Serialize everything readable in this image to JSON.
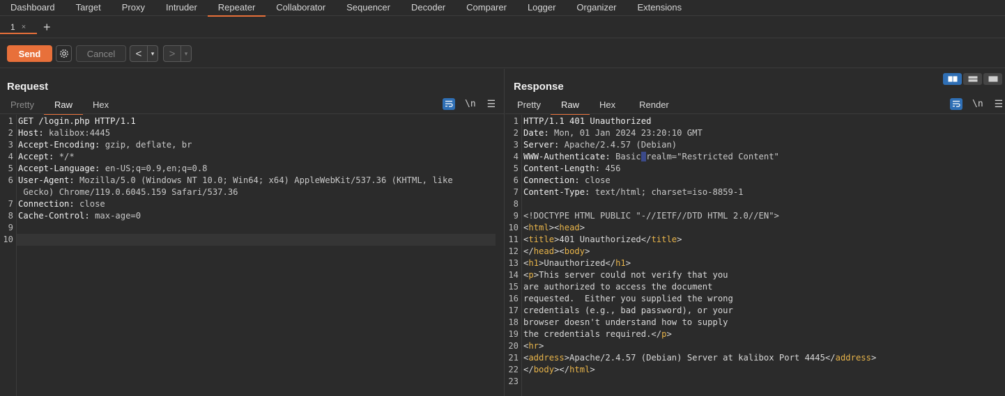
{
  "topnav": [
    "Dashboard",
    "Target",
    "Proxy",
    "Intruder",
    "Repeater",
    "Collaborator",
    "Sequencer",
    "Decoder",
    "Comparer",
    "Logger",
    "Organizer",
    "Extensions"
  ],
  "subtabs": {
    "tab_label": "1",
    "close": "×",
    "add": "+"
  },
  "toolbar": {
    "send": "Send",
    "cancel": "Cancel",
    "back": "<",
    "forward": ">",
    "drop": "▾"
  },
  "request": {
    "title": "Request",
    "tabs": [
      "Pretty",
      "Raw",
      "Hex"
    ],
    "nl": "\\n",
    "lines": [
      {
        "n": "1",
        "k": "",
        "v": "GET /login.php HTTP/1.1"
      },
      {
        "n": "2",
        "k": "Host:",
        "v": " kalibox:4445"
      },
      {
        "n": "3",
        "k": "Accept-Encoding:",
        "v": " gzip, deflate, br"
      },
      {
        "n": "4",
        "k": "Accept:",
        "v": " */*"
      },
      {
        "n": "5",
        "k": "Accept-Language:",
        "v": " en-US;q=0.9,en;q=0.8"
      },
      {
        "n": "6",
        "k": "User-Agent:",
        "v": " Mozilla/5.0 (Windows NT 10.0; Win64; x64) AppleWebKit/537.36 (KHTML, like"
      },
      {
        "n": "",
        "k": "",
        "v": " Gecko) Chrome/119.0.6045.159 Safari/537.36"
      },
      {
        "n": "7",
        "k": "Connection:",
        "v": " close"
      },
      {
        "n": "8",
        "k": "Cache-Control:",
        "v": " max-age=0"
      },
      {
        "n": "9",
        "k": "",
        "v": ""
      },
      {
        "n": "10",
        "k": "",
        "v": ""
      }
    ]
  },
  "response": {
    "title": "Response",
    "tabs": [
      "Pretty",
      "Raw",
      "Hex",
      "Render"
    ],
    "nl": "\\n",
    "header_lines": [
      {
        "n": "1",
        "k": "",
        "v": "HTTP/1.1 401 Unauthorized"
      },
      {
        "n": "2",
        "k": "Date:",
        "v": " Mon, 01 Jan 2024 23:20:10 GMT"
      },
      {
        "n": "3",
        "k": "Server:",
        "v": " Apache/2.4.57 (Debian)"
      },
      {
        "n": "5",
        "k": "Content-Length:",
        "v": " 456"
      },
      {
        "n": "6",
        "k": "Connection:",
        "v": " close"
      },
      {
        "n": "7",
        "k": "Content-Type:",
        "v": " text/html; charset=iso-8859-1"
      },
      {
        "n": "8",
        "k": "",
        "v": ""
      }
    ],
    "www_auth": {
      "n": "4",
      "k": "WWW-Authenticate:",
      "v1": " Basic",
      "sp": " ",
      "v2": "realm=\"Restricted Content\""
    },
    "doctype": {
      "n": "9",
      "v": "<!DOCTYPE HTML PUBLIC \"-//IETF//DTD HTML 2.0//EN\">"
    },
    "body": {
      "l10": {
        "n": "10",
        "a": "<",
        "t1": "html",
        "b": "><",
        "t2": "head",
        "c": ">"
      },
      "l11": {
        "n": "11",
        "a": "<",
        "t1": "title",
        "b": ">401 Unauthorized</",
        "t2": "title",
        "c": ">"
      },
      "l12": {
        "n": "12",
        "a": "</",
        "t1": "head",
        "b": "><",
        "t2": "body",
        "c": ">"
      },
      "l13": {
        "n": "13",
        "a": "<",
        "t1": "h1",
        "b": ">Unauthorized</",
        "t2": "h1",
        "c": ">"
      },
      "l14": {
        "n": "14",
        "a": "<",
        "t1": "p",
        "b": ">This server could not verify that you"
      },
      "l15": {
        "n": "15",
        "v": "are authorized to access the document"
      },
      "l16": {
        "n": "16",
        "v": "requested.  Either you supplied the wrong"
      },
      "l17": {
        "n": "17",
        "v": "credentials (e.g., bad password), or your"
      },
      "l18": {
        "n": "18",
        "v": "browser doesn't understand how to supply"
      },
      "l19": {
        "n": "19",
        "a": "the credentials required.</",
        "t1": "p",
        "b": ">"
      },
      "l20": {
        "n": "20",
        "a": "<",
        "t1": "hr",
        "b": ">"
      },
      "l21": {
        "n": "21",
        "a": "<",
        "t1": "address",
        "b": ">Apache/2.4.57 (Debian) Server at kalibox Port 4445</",
        "t2": "address",
        "c": ">"
      },
      "l22": {
        "n": "22",
        "a": "</",
        "t1": "body",
        "b": "></",
        "t2": "html",
        "c": ">"
      },
      "l23": {
        "n": "23",
        "v": ""
      }
    }
  },
  "colors": {
    "accent": "#e8703a",
    "blue": "#2f6fb5",
    "tag": "#e8b44a"
  }
}
